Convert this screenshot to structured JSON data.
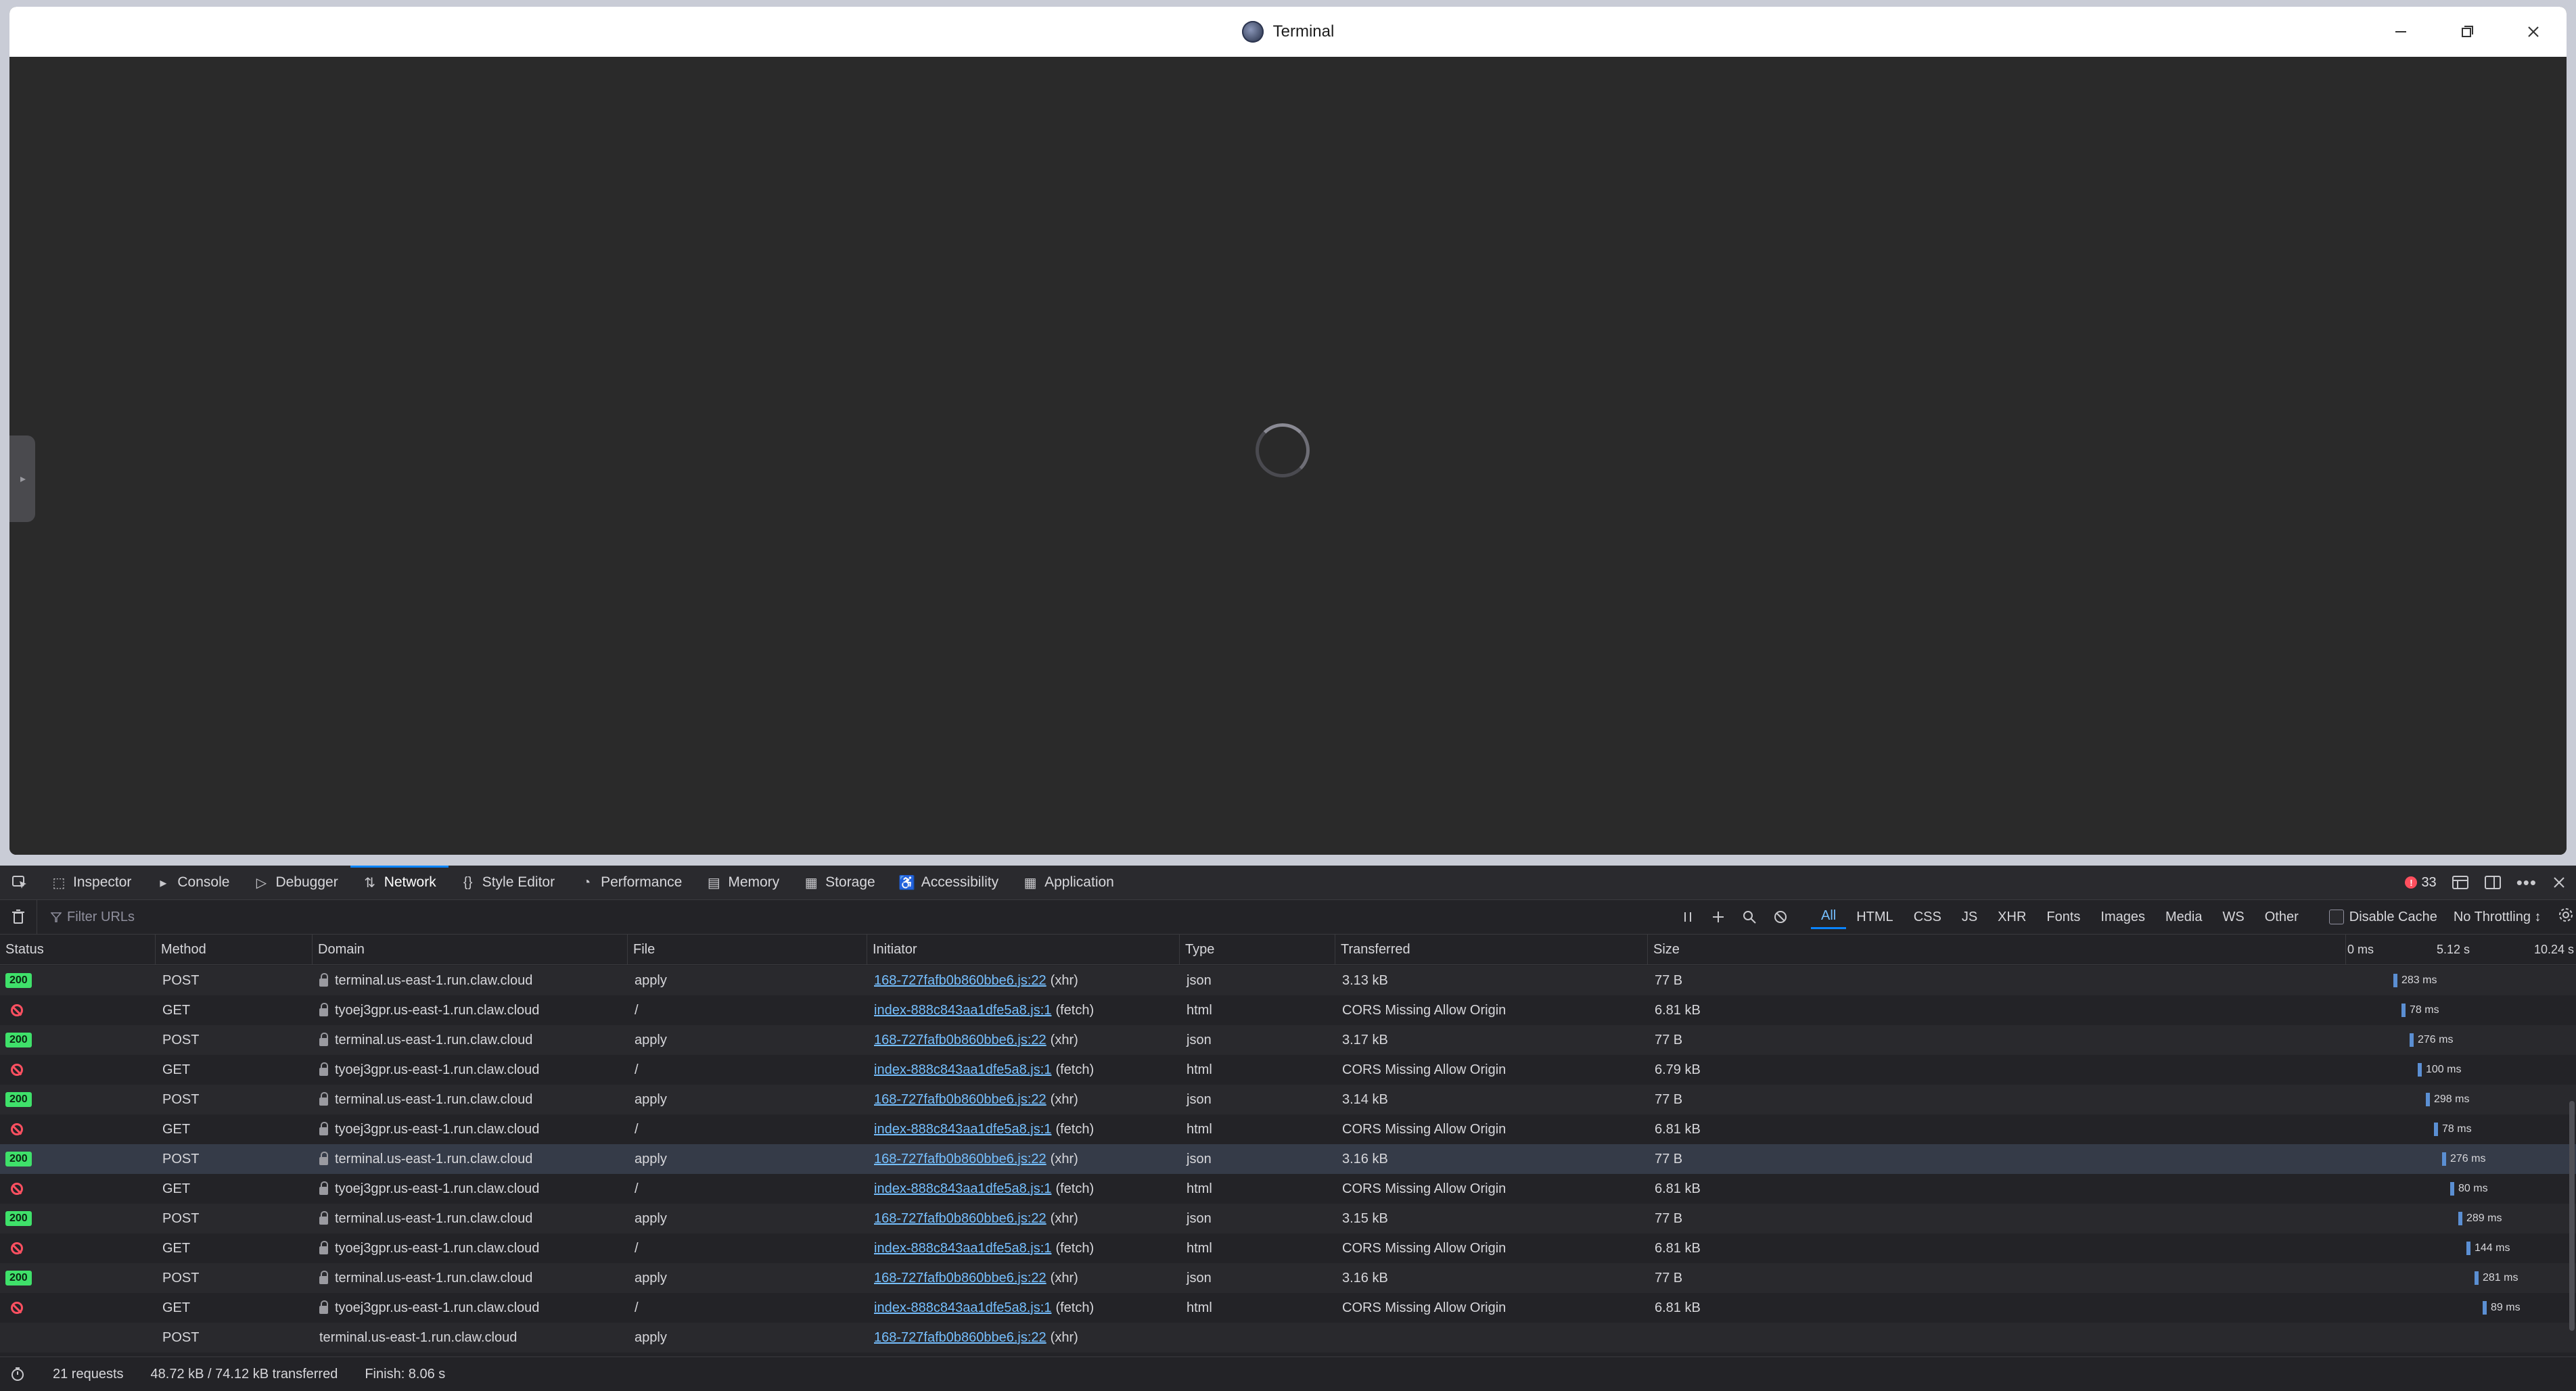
{
  "window": {
    "title": "Terminal"
  },
  "devtools": {
    "tabs": [
      {
        "label": "Inspector",
        "icon": "inspector-icon"
      },
      {
        "label": "Console",
        "icon": "console-icon"
      },
      {
        "label": "Debugger",
        "icon": "debugger-icon"
      },
      {
        "label": "Network",
        "icon": "network-icon"
      },
      {
        "label": "Style Editor",
        "icon": "style-editor-icon"
      },
      {
        "label": "Performance",
        "icon": "performance-icon"
      },
      {
        "label": "Memory",
        "icon": "memory-icon"
      },
      {
        "label": "Storage",
        "icon": "storage-icon"
      },
      {
        "label": "Accessibility",
        "icon": "accessibility-icon"
      },
      {
        "label": "Application",
        "icon": "application-icon"
      }
    ],
    "active_tab": "Network",
    "error_count": "33",
    "filter_placeholder": "Filter URLs",
    "type_filters": [
      "All",
      "HTML",
      "CSS",
      "JS",
      "XHR",
      "Fonts",
      "Images",
      "Media",
      "WS",
      "Other"
    ],
    "active_type": "All",
    "disable_cache_label": "Disable Cache",
    "throttling": "No Throttling ↕",
    "columns": {
      "status": "Status",
      "method": "Method",
      "domain": "Domain",
      "file": "File",
      "initiator": "Initiator",
      "type": "Type",
      "transferred": "Transferred",
      "size": "Size"
    },
    "waterfall_ticks": [
      "0 ms",
      "5.12 s",
      "10.24 s"
    ],
    "rows": [
      {
        "status": "200",
        "method": "POST",
        "domain": "terminal.us-east-1.run.claw.cloud",
        "file": "apply",
        "initiator": "168-727fafb0b860bbe6.js:22",
        "initiator_kind": "(xhr)",
        "type": "json",
        "transferred": "3.13 kB",
        "size": "77 B",
        "timing": "283 ms"
      },
      {
        "status": "blocked",
        "method": "GET",
        "domain": "tyoej3gpr.us-east-1.run.claw.cloud",
        "file": "/",
        "initiator": "index-888c843aa1dfe5a8.js:1",
        "initiator_kind": "(fetch)",
        "type": "html",
        "transferred": "CORS Missing Allow Origin",
        "size": "6.81 kB",
        "timing": "78 ms"
      },
      {
        "status": "200",
        "method": "POST",
        "domain": "terminal.us-east-1.run.claw.cloud",
        "file": "apply",
        "initiator": "168-727fafb0b860bbe6.js:22",
        "initiator_kind": "(xhr)",
        "type": "json",
        "transferred": "3.17 kB",
        "size": "77 B",
        "timing": "276 ms"
      },
      {
        "status": "blocked",
        "method": "GET",
        "domain": "tyoej3gpr.us-east-1.run.claw.cloud",
        "file": "/",
        "initiator": "index-888c843aa1dfe5a8.js:1",
        "initiator_kind": "(fetch)",
        "type": "html",
        "transferred": "CORS Missing Allow Origin",
        "size": "6.79 kB",
        "timing": "100 ms"
      },
      {
        "status": "200",
        "method": "POST",
        "domain": "terminal.us-east-1.run.claw.cloud",
        "file": "apply",
        "initiator": "168-727fafb0b860bbe6.js:22",
        "initiator_kind": "(xhr)",
        "type": "json",
        "transferred": "3.14 kB",
        "size": "77 B",
        "timing": "298 ms"
      },
      {
        "status": "blocked",
        "method": "GET",
        "domain": "tyoej3gpr.us-east-1.run.claw.cloud",
        "file": "/",
        "initiator": "index-888c843aa1dfe5a8.js:1",
        "initiator_kind": "(fetch)",
        "type": "html",
        "transferred": "CORS Missing Allow Origin",
        "size": "6.81 kB",
        "timing": "78 ms"
      },
      {
        "status": "200",
        "method": "POST",
        "domain": "terminal.us-east-1.run.claw.cloud",
        "file": "apply",
        "initiator": "168-727fafb0b860bbe6.js:22",
        "initiator_kind": "(xhr)",
        "type": "json",
        "transferred": "3.16 kB",
        "size": "77 B",
        "timing": "276 ms",
        "selected": true
      },
      {
        "status": "blocked",
        "method": "GET",
        "domain": "tyoej3gpr.us-east-1.run.claw.cloud",
        "file": "/",
        "initiator": "index-888c843aa1dfe5a8.js:1",
        "initiator_kind": "(fetch)",
        "type": "html",
        "transferred": "CORS Missing Allow Origin",
        "size": "6.81 kB",
        "timing": "80 ms"
      },
      {
        "status": "200",
        "method": "POST",
        "domain": "terminal.us-east-1.run.claw.cloud",
        "file": "apply",
        "initiator": "168-727fafb0b860bbe6.js:22",
        "initiator_kind": "(xhr)",
        "type": "json",
        "transferred": "3.15 kB",
        "size": "77 B",
        "timing": "289 ms"
      },
      {
        "status": "blocked",
        "method": "GET",
        "domain": "tyoej3gpr.us-east-1.run.claw.cloud",
        "file": "/",
        "initiator": "index-888c843aa1dfe5a8.js:1",
        "initiator_kind": "(fetch)",
        "type": "html",
        "transferred": "CORS Missing Allow Origin",
        "size": "6.81 kB",
        "timing": "144 ms"
      },
      {
        "status": "200",
        "method": "POST",
        "domain": "terminal.us-east-1.run.claw.cloud",
        "file": "apply",
        "initiator": "168-727fafb0b860bbe6.js:22",
        "initiator_kind": "(xhr)",
        "type": "json",
        "transferred": "3.16 kB",
        "size": "77 B",
        "timing": "281 ms"
      },
      {
        "status": "blocked",
        "method": "GET",
        "domain": "tyoej3gpr.us-east-1.run.claw.cloud",
        "file": "/",
        "initiator": "index-888c843aa1dfe5a8.js:1",
        "initiator_kind": "(fetch)",
        "type": "html",
        "transferred": "CORS Missing Allow Origin",
        "size": "6.81 kB",
        "timing": "89 ms"
      },
      {
        "status": "",
        "method": "POST",
        "domain": "terminal.us-east-1.run.claw.cloud",
        "file": "apply",
        "initiator": "168-727fafb0b860bbe6.js:22",
        "initiator_kind": "(xhr)",
        "type": "",
        "transferred": "",
        "size": "",
        "timing": "",
        "pending": true
      }
    ],
    "summary": {
      "requests": "21 requests",
      "transferred": "48.72 kB / 74.12 kB transferred",
      "finish": "Finish: 8.06 s"
    }
  }
}
